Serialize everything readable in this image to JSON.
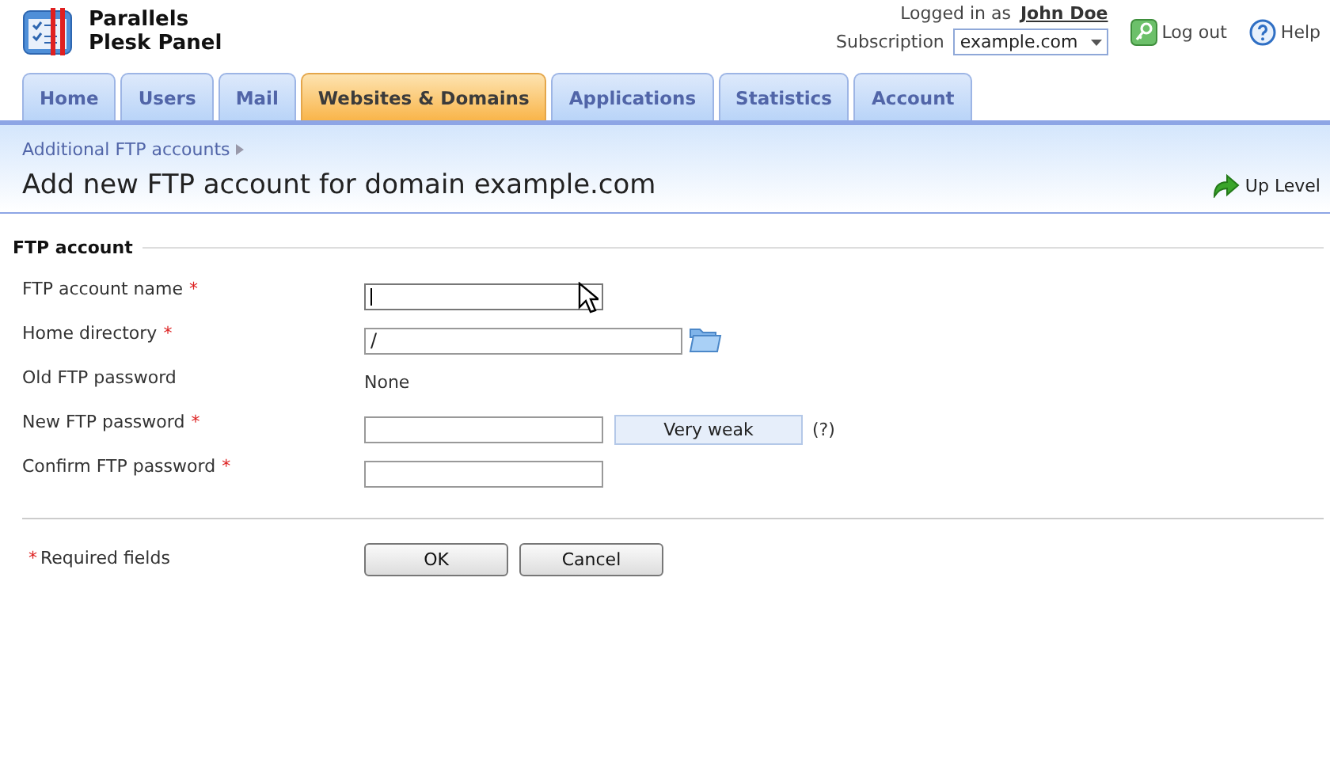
{
  "product": {
    "name_line1": "Parallels",
    "name_line2": "Plesk Panel"
  },
  "user": {
    "logged_in_label": "Logged in as",
    "name": "John Doe",
    "subscription_label": "Subscription",
    "subscription": "example.com",
    "logout": "Log out",
    "help": "Help"
  },
  "tabs": [
    {
      "label": "Home",
      "selected": false
    },
    {
      "label": "Users",
      "selected": false
    },
    {
      "label": "Mail",
      "selected": false
    },
    {
      "label": "Websites & Domains",
      "selected": true
    },
    {
      "label": "Applications",
      "selected": false
    },
    {
      "label": "Statistics",
      "selected": false
    },
    {
      "label": "Account",
      "selected": false
    }
  ],
  "breadcrumb": "Additional FTP accounts",
  "page_title": "Add new FTP account for domain example.com",
  "up_level": "Up Level",
  "section": "FTP account",
  "fields": [
    {
      "kind": "text",
      "label": "FTP account name",
      "required_mark": "*",
      "focused": true
    },
    {
      "kind": "folder",
      "label": "Home directory",
      "required_mark": "*",
      "value": "/"
    },
    {
      "kind": "static",
      "label": "Old FTP password",
      "value": "None"
    },
    {
      "kind": "password",
      "label": "New FTP password",
      "required_mark": "*",
      "strength": "Very weak",
      "hint": "(?)"
    },
    {
      "kind": "text",
      "label": "Confirm FTP password",
      "required_mark": "*"
    }
  ],
  "required_note": {
    "mark": "*",
    "text": "Required fields"
  },
  "buttons": [
    "OK",
    "Cancel"
  ]
}
